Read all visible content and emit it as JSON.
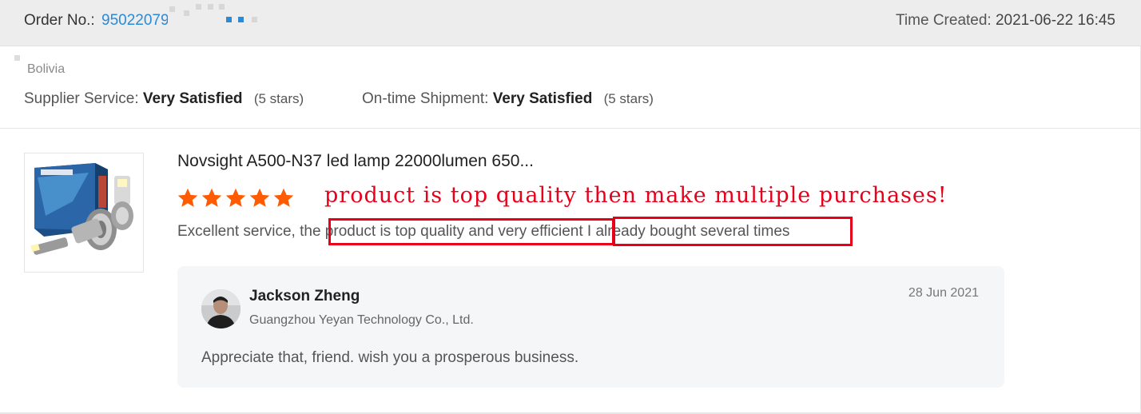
{
  "header": {
    "order_label": "Order No.:",
    "order_number": "95022079",
    "time_label": "Time Created:",
    "time_value": "2021-06-22 16:45"
  },
  "buyer": {
    "country": "Bolivia"
  },
  "ratings": {
    "supplier_service_label": "Supplier Service:",
    "supplier_service_value": "Very Satisfied",
    "supplier_service_stars": "(5 stars)",
    "shipment_label": "On-time Shipment:",
    "shipment_value": "Very Satisfied",
    "shipment_stars": "(5 stars)"
  },
  "product": {
    "title": "Novsight A500-N37 led lamp 22000lumen 650...",
    "rating": 5,
    "rating_max": 5,
    "thumbnail_brand": "NOVSIGHT"
  },
  "annotation": {
    "text": "product is top quality then make multiple purchases!"
  },
  "review": {
    "text": "Excellent service, the product is top quality and very efficient I already bought several times"
  },
  "reply": {
    "name": "Jackson Zheng",
    "company": "Guangzhou Yeyan Technology Co., Ltd.",
    "date": "28 Jun 2021",
    "body": "Appreciate that, friend. wish you a prosperous business."
  },
  "colors": {
    "link_blue": "#2a8ad8",
    "star_orange": "#ff5b00",
    "annotation_red": "#e8001a",
    "header_bg": "#ededed",
    "reply_bg": "#f5f6f8"
  },
  "icons": {
    "rating_star": "star-icon"
  }
}
